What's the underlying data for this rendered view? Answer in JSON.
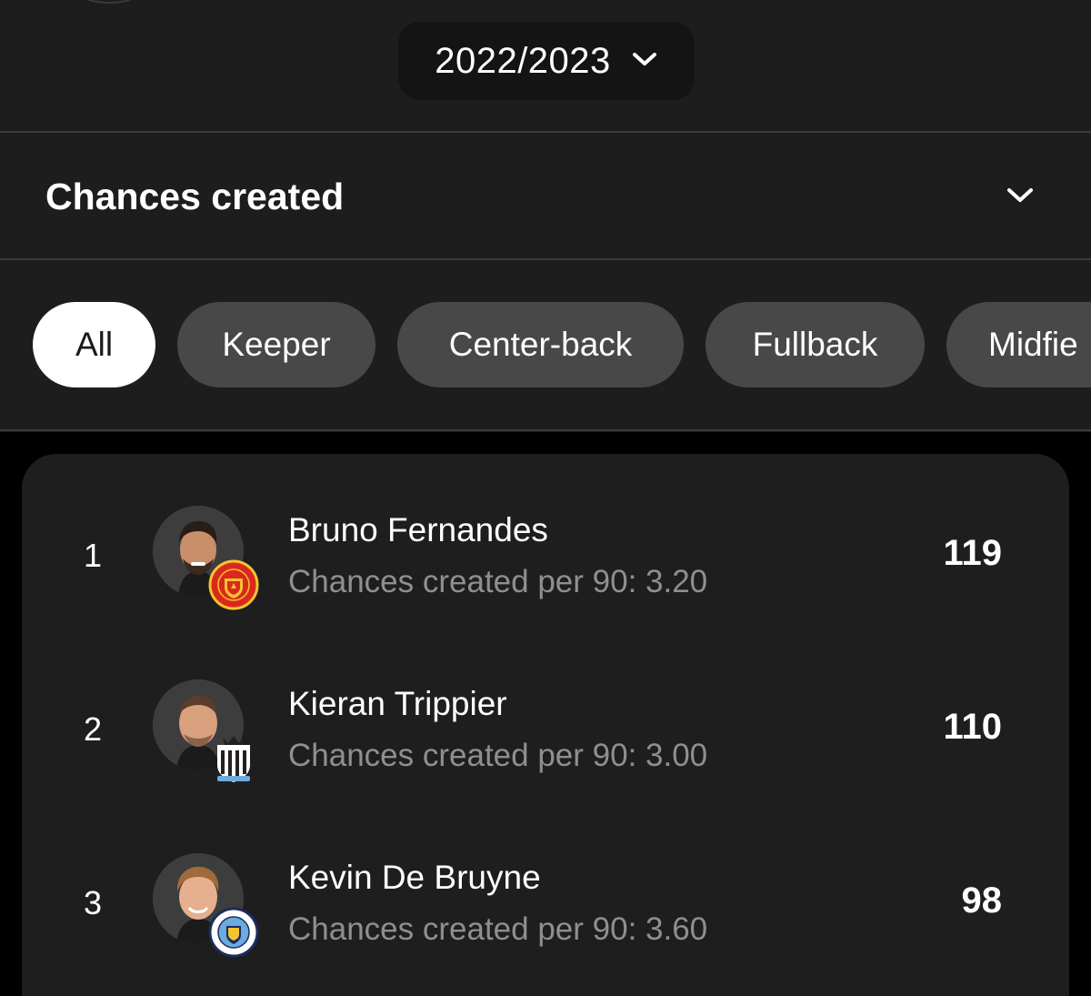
{
  "season": {
    "selected": "2022/2023",
    "chevron_icon": "chevron-down-icon"
  },
  "stat": {
    "title": "Chances created",
    "chevron_icon": "chevron-down-icon"
  },
  "filters": [
    {
      "label": "All",
      "active": true
    },
    {
      "label": "Keeper",
      "active": false
    },
    {
      "label": "Center-back",
      "active": false
    },
    {
      "label": "Fullback",
      "active": false
    },
    {
      "label": "Midfie",
      "active": false
    }
  ],
  "players": [
    {
      "rank": "1",
      "name": "Bruno Fernandes",
      "sub": "Chances created per 90: 3.20",
      "value": "119",
      "club_badge": "manchester-united-badge-icon",
      "badge_color": "#da291c"
    },
    {
      "rank": "2",
      "name": "Kieran Trippier",
      "sub": "Chances created per 90: 3.00",
      "value": "110",
      "club_badge": "newcastle-united-badge-icon",
      "badge_color": "#241f20"
    },
    {
      "rank": "3",
      "name": "Kevin De Bruyne",
      "sub": "Chances created per 90: 3.60",
      "value": "98",
      "club_badge": "manchester-city-badge-icon",
      "badge_color": "#6cabdd"
    }
  ],
  "colors": {
    "page_bg": "#000000",
    "panel_bg": "#1d1d1d",
    "chip_bg": "#484848",
    "chip_active_bg": "#ffffff",
    "subtext": "#8f8f8f"
  }
}
